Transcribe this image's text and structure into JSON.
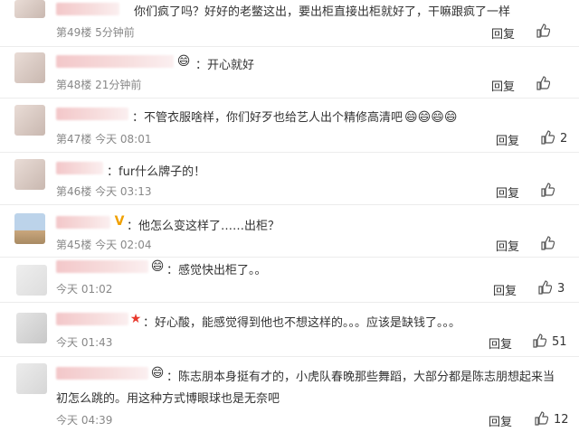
{
  "comments": [
    {
      "text": "你们疯了吗？好好的老鳖这出，要出柜直接出柜就好了，干嘛跟疯了一样",
      "meta": "第49楼  5分钟前",
      "reply": "回复",
      "likes": "",
      "badge": ""
    },
    {
      "text": "开心就好",
      "meta": "第48楼  21分钟前",
      "reply": "回复",
      "likes": "",
      "badge": "emoji-badge"
    },
    {
      "text": "不管衣服啥样，你们好歹也给艺人出个精修高清吧",
      "meta": "第47楼  今天 08:01",
      "reply": "回复",
      "likes": "2",
      "badge": ""
    },
    {
      "text": "fur什么牌子的！",
      "meta": "第46楼  今天 03:13",
      "reply": "回复",
      "likes": "",
      "badge": ""
    },
    {
      "text": "他怎么变这样了……出柜？",
      "meta": "第45楼  今天 02:04",
      "reply": "回复",
      "likes": "",
      "badge": "v-badge"
    },
    {
      "text": "感觉快出柜了。。",
      "meta": "今天 01:02",
      "reply": "回复",
      "likes": "3",
      "badge": "emoji-badge"
    },
    {
      "text": "好心酸，能感觉得到他也不想这样的。。。应该是缺钱了。。。",
      "meta": "今天 01:43",
      "reply": "回复",
      "likes": "51",
      "badge": "star-badge"
    },
    {
      "text": "陈志朋本身挺有才的，小虎队春晚那些舞蹈，大部分都是陈志朋想起来当",
      "text2": "初怎么跳的。用这种方式博眼球也是无奈吧",
      "meta": "今天 04:39",
      "reply": "回复",
      "likes": "12",
      "badge": "emoji-badge"
    }
  ],
  "emoji_glyph": "😄",
  "badge_glyphs": {
    "v": "V",
    "star": "★",
    "emoji": "😄"
  }
}
